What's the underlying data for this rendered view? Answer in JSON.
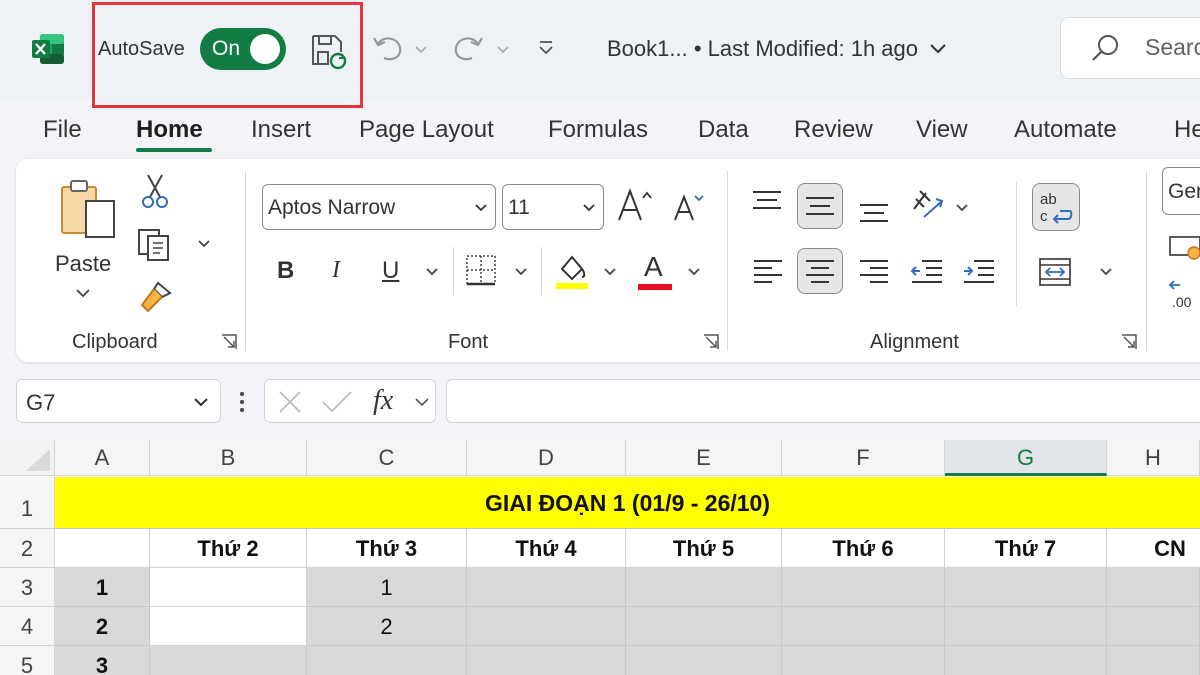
{
  "titlebar": {
    "autosave_label": "AutoSave",
    "autosave_state": "On",
    "doc_title": "Book1...  •  Last Modified: 1h ago",
    "search_placeholder": "Search"
  },
  "tabs": [
    {
      "label": "File"
    },
    {
      "label": "Home",
      "active": true
    },
    {
      "label": "Insert"
    },
    {
      "label": "Page Layout"
    },
    {
      "label": "Formulas"
    },
    {
      "label": "Data"
    },
    {
      "label": "Review"
    },
    {
      "label": "View"
    },
    {
      "label": "Automate"
    },
    {
      "label": "Help"
    }
  ],
  "ribbon": {
    "clipboard": {
      "label": "Clipboard",
      "paste_label": "Paste"
    },
    "font": {
      "label": "Font",
      "font_name": "Aptos Narrow",
      "font_size": "11",
      "bold": "B",
      "italic": "I",
      "underline": "U",
      "font_color_letter": "A",
      "highlight_color": "#ffff00",
      "font_color": "#e81123"
    },
    "alignment": {
      "label": "Alignment",
      "wrap_text": "ab\nc"
    },
    "number": {
      "format": "General"
    }
  },
  "formula_bar": {
    "name_box": "G7",
    "fx_label": "fx",
    "formula": ""
  },
  "sheet": {
    "columns": [
      "A",
      "B",
      "C",
      "D",
      "E",
      "F",
      "G",
      "H"
    ],
    "selected_column": "G",
    "rows": [
      "1",
      "2",
      "3",
      "4",
      "5"
    ],
    "title": "GIAI ĐOẠN 1 (01/9 - 26/10)",
    "weekday_headers": [
      "Thứ 2",
      "Thứ 3",
      "Thứ 4",
      "Thứ 5",
      "Thứ 6",
      "Thứ 7",
      "CN"
    ],
    "week_numbers": [
      "1",
      "2",
      "3"
    ],
    "c_values": [
      "1",
      "2"
    ]
  },
  "colors": {
    "accent": "#137b44",
    "title_fill": "#ffff00",
    "cell_gray": "#d9d9d9",
    "highlight_box": "#e5373a"
  }
}
